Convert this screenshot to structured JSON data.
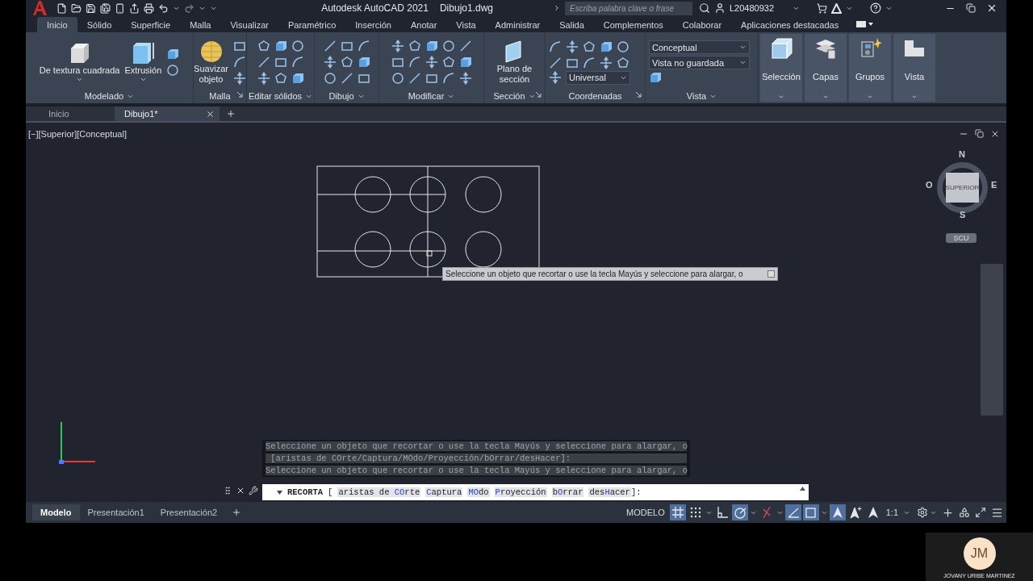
{
  "window": {
    "title": "Autodesk AutoCAD 2021",
    "file": "Dibujo1.dwg"
  },
  "search": {
    "placeholder": "Escriba palabra clave o frase"
  },
  "user": {
    "name": "L20480932"
  },
  "menu_tabs": [
    {
      "label": "Inicio",
      "selected": true
    },
    {
      "label": "Sólido",
      "selected": false
    },
    {
      "label": "Superficie",
      "selected": false
    },
    {
      "label": "Malla",
      "selected": false
    },
    {
      "label": "Visualizar",
      "selected": false
    },
    {
      "label": "Paramétrico",
      "selected": false
    },
    {
      "label": "Inserción",
      "selected": false
    },
    {
      "label": "Anotar",
      "selected": false
    },
    {
      "label": "Vista",
      "selected": false
    },
    {
      "label": "Administrar",
      "selected": false
    },
    {
      "label": "Salida",
      "selected": false
    },
    {
      "label": "Complementos",
      "selected": false
    },
    {
      "label": "Colaborar",
      "selected": false
    },
    {
      "label": "Aplicaciones destacadas",
      "selected": false
    }
  ],
  "ribbon": {
    "panels": [
      {
        "title": "Modelado",
        "caret": true,
        "launcher": false,
        "items": [
          {
            "kind": "big",
            "label": "De textura cuadrada",
            "menu": true
          },
          {
            "kind": "big",
            "label": "Extrusión",
            "menu": true
          },
          {
            "kind": "tools"
          }
        ]
      },
      {
        "title": "Malla",
        "caret": false,
        "launcher": true,
        "items": [
          {
            "kind": "big",
            "label": "Suavizar objeto",
            "menu": false
          },
          {
            "kind": "tools"
          }
        ]
      },
      {
        "title": "Editar sólidos",
        "caret": true,
        "launcher": false,
        "items": [
          {
            "kind": "tools"
          }
        ]
      },
      {
        "title": "Dibujo",
        "caret": true,
        "launcher": false,
        "items": [
          {
            "kind": "tools"
          }
        ]
      },
      {
        "title": "Modificar",
        "caret": true,
        "launcher": false,
        "items": [
          {
            "kind": "tools"
          }
        ]
      },
      {
        "title": "Sección",
        "caret": true,
        "launcher": true,
        "items": [
          {
            "kind": "big",
            "label": "Plano de sección",
            "menu": false
          }
        ]
      },
      {
        "title": "Coordenadas",
        "caret": false,
        "launcher": true,
        "items": [
          {
            "kind": "tools"
          },
          {
            "kind": "dropdown",
            "label": "Universal"
          }
        ]
      },
      {
        "title": "Vista",
        "caret": true,
        "launcher": false,
        "items": [
          {
            "kind": "dropdown",
            "label": "Conceptual"
          },
          {
            "kind": "dropdown",
            "label": "Vista no guardada"
          },
          {
            "kind": "tools"
          }
        ]
      }
    ],
    "tool_buttons": [
      {
        "label": "Selección"
      },
      {
        "label": "Capas"
      },
      {
        "label": "Grupos"
      },
      {
        "label": "Vista"
      }
    ]
  },
  "file_tabs": [
    {
      "label": "Inicio",
      "selected": false,
      "closable": false
    },
    {
      "label": "Dibujo1*",
      "selected": true,
      "closable": true
    }
  ],
  "viewport": {
    "label": "[−][Superior][Conceptual]",
    "tooltip": "Seleccione un objeto que recortar o use la tecla Mayús y seleccione para alargar, o",
    "viewcube": {
      "north": "N",
      "west": "O",
      "east": "E",
      "south": "S",
      "face": "SUPERIOR",
      "ucs": "SCU"
    }
  },
  "command": {
    "history": [
      "Seleccione un objeto que recortar o use la tecla Mayús y seleccione para alargar, o",
      " [aristas de COrte/Captura/MOdo/Proyección/bOrrar/desHacer]:",
      "Seleccione un objeto que recortar o use la tecla Mayús y seleccione para alargar, o"
    ],
    "name": "RECORTA",
    "open": "[",
    "options": [
      "aristas de **CO**rte",
      "**C**aptura",
      "**MO**do",
      "**P**royección",
      "b**O**rrar",
      "des**H**acer"
    ],
    "close": "]:"
  },
  "layout_tabs": [
    {
      "label": "Modelo",
      "selected": true
    },
    {
      "label": "Presentación1",
      "selected": false
    },
    {
      "label": "Presentación2",
      "selected": false
    }
  ],
  "status_bar": {
    "space": "MODELO",
    "toggles": [
      {
        "kind": "grid",
        "on": true,
        "menu": false
      },
      {
        "kind": "snap",
        "on": false,
        "menu": true
      },
      {
        "kind": "ortho",
        "on": false,
        "menu": false
      },
      {
        "kind": "polar",
        "on": true,
        "menu": true
      },
      {
        "kind": "isodraft",
        "on": false,
        "menu": true
      },
      {
        "kind": "tracking",
        "on": true,
        "menu": false
      },
      {
        "kind": "osnap",
        "on": true,
        "menu": true
      },
      {
        "kind": "annotation",
        "on": true,
        "menu": false
      },
      {
        "kind": "autoscale",
        "on": false,
        "menu": false
      },
      {
        "kind": "annoscale",
        "on": false,
        "menu": false
      }
    ],
    "scale": "1:1"
  },
  "participant": {
    "initials": "JM",
    "name": "JOVANY URIBE MARTINEZ"
  }
}
